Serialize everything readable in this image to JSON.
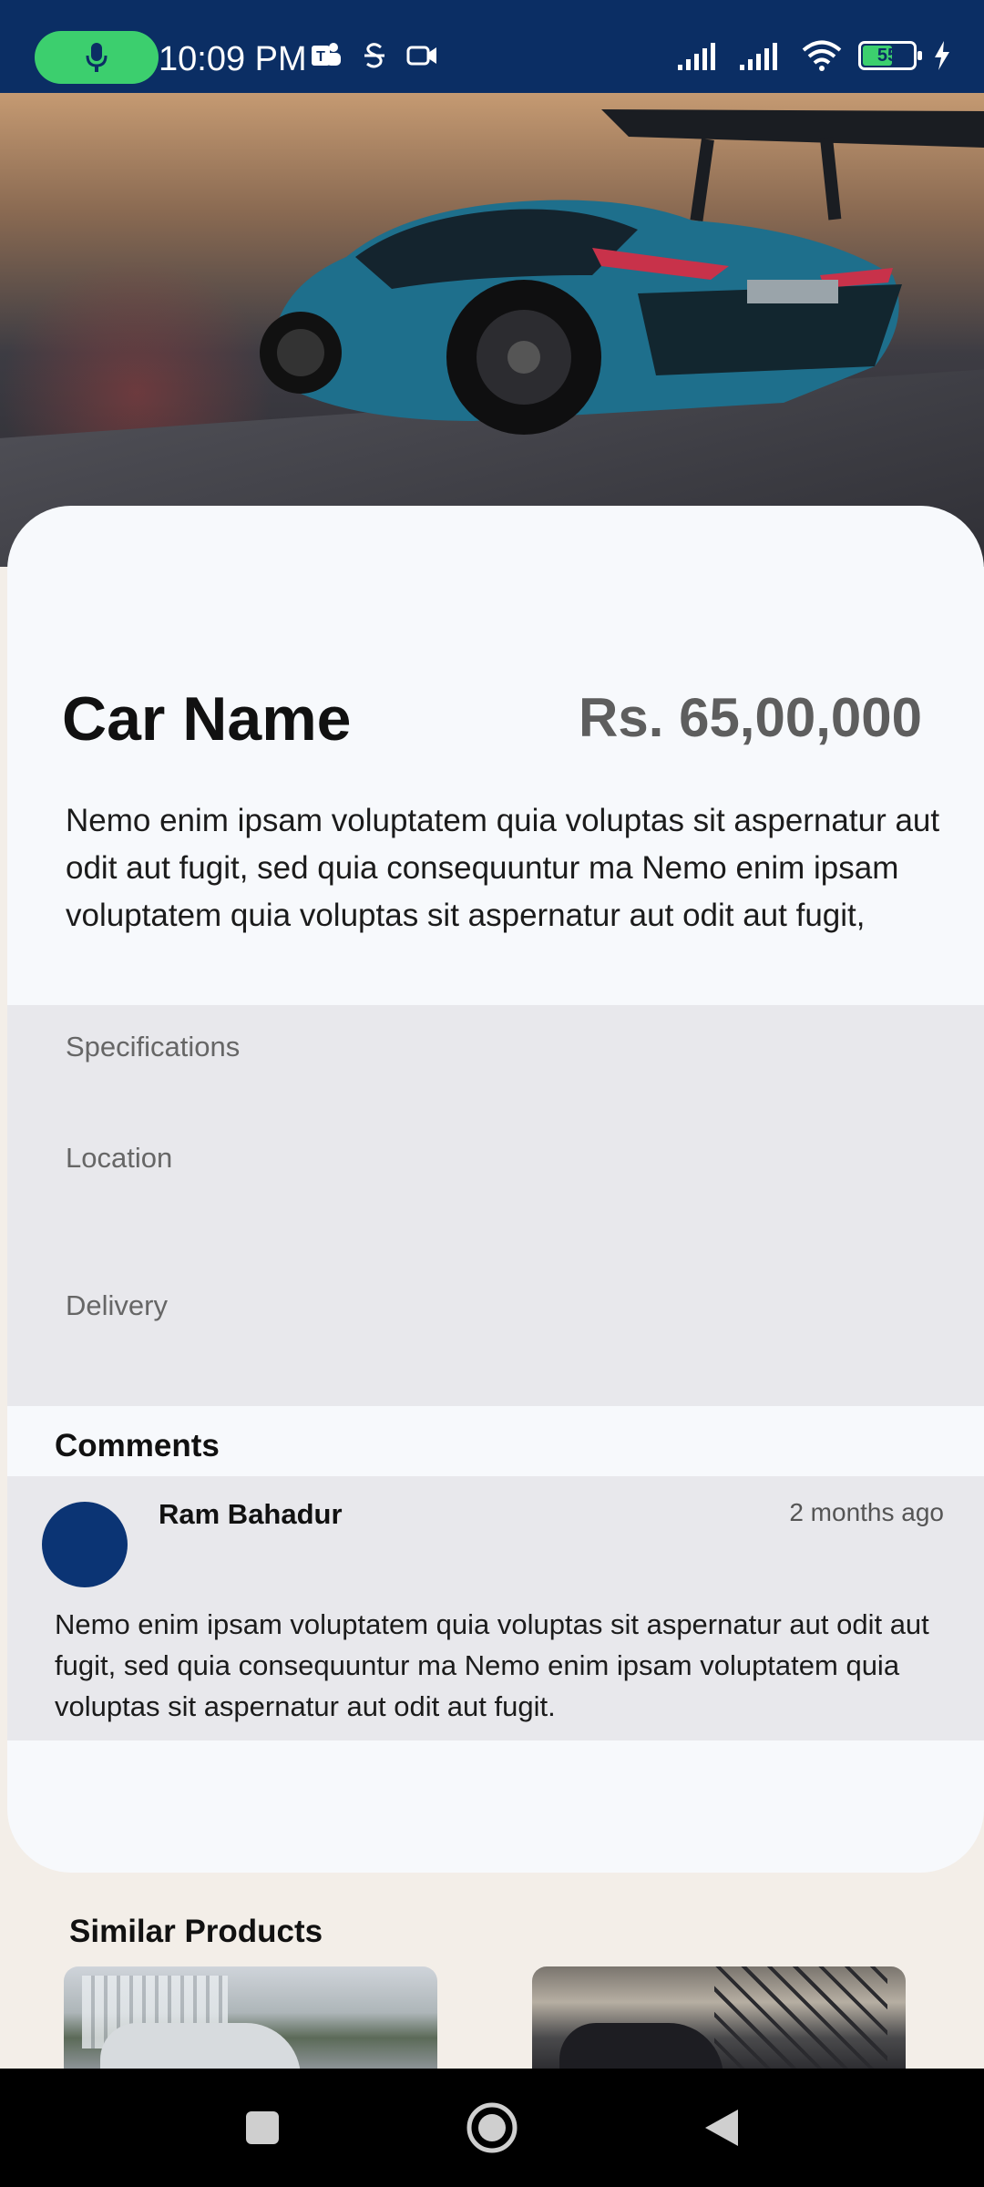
{
  "status_bar": {
    "time": "10:09 PM",
    "battery_level": "55",
    "icons": [
      "mic-icon",
      "teams-icon",
      "strikethrough-s-icon",
      "video-camera-icon",
      "signal-icon",
      "signal-icon",
      "wifi-icon",
      "battery-icon",
      "charging-bolt-icon"
    ]
  },
  "hero": {
    "image": "blue-sports-car-photo"
  },
  "product": {
    "name": "Car Name",
    "price": "Rs. 65,00,000",
    "description": "Nemo enim ipsam voluptatem quia voluptas sit aspernatur aut odit aut fugit, sed quia consequuntur ma Nemo enim ipsam voluptatem quia voluptas sit aspernatur aut odit aut fugit,"
  },
  "details": {
    "specifications": "Specifications",
    "location": "Location",
    "delivery": "Delivery"
  },
  "comments": {
    "title": "Comments",
    "items": [
      {
        "author": "Ram Bahadur",
        "time": "2 months ago",
        "text": "Nemo enim ipsam voluptatem quia voluptas sit aspernatur aut odit aut fugit, sed quia consequuntur ma Nemo enim ipsam voluptatem quia voluptas sit aspernatur aut odit aut fugit."
      }
    ]
  },
  "similar": {
    "title": "Similar Products"
  },
  "nav": {
    "buttons": [
      "recents-square-icon",
      "home-circle-icon",
      "back-triangle-icon"
    ]
  },
  "colors": {
    "status_bar": "#0b2e64",
    "mic_pill": "#3ccf6e",
    "avatar": "#0b3474",
    "card": "#f7f9fc",
    "section_gray": "#e8e8ec"
  }
}
